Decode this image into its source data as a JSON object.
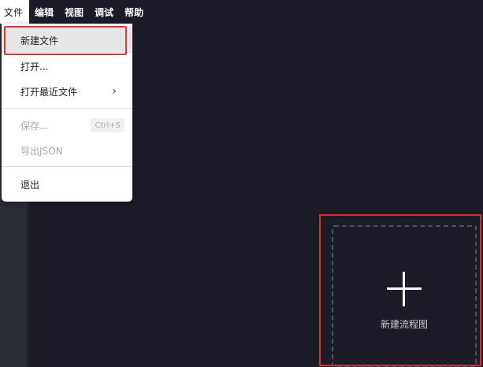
{
  "menubar": {
    "items": [
      {
        "label": "文件"
      },
      {
        "label": "编辑"
      },
      {
        "label": "视图"
      },
      {
        "label": "调试"
      },
      {
        "label": "帮助"
      }
    ]
  },
  "file_menu": {
    "new_file": "新建文件",
    "open": "打开...",
    "open_recent": "打开最近文件",
    "open_recent_chevron": "›",
    "save": "保存...",
    "save_shortcut": "Ctrl+S",
    "export_json": "导出JSON",
    "exit": "退出"
  },
  "canvas": {
    "new_flow_label": "新建流程图"
  },
  "colors": {
    "background": "#1b1c27",
    "highlight_border": "#d32f2f"
  }
}
